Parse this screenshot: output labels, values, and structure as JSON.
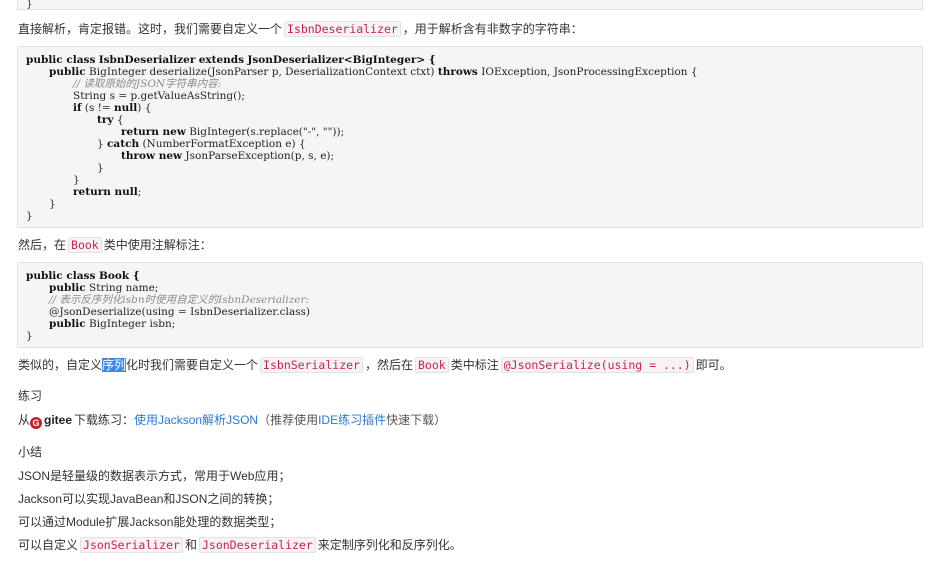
{
  "top_code": {
    "closing_brace": "}"
  },
  "intro": {
    "text_before": "直接解析，肯定报错。这时，我们需要自定义一个",
    "code": "IsbnDeserializer",
    "text_after": "，用于解析含有非数字的字符串："
  },
  "code_block_1": {
    "l1_kw": "public class",
    "l1_name": "IsbnDeserializer",
    "l1_kw2": "extends",
    "l1_parent": "JsonDeserializer<BigInteger> {",
    "l2_kw": "public",
    "l2_rest": " BigInteger deserialize(JsonParser p, DeserializationContext ctxt) ",
    "l2_kw2": "throws",
    "l2_rest2": " IOException, JsonProcessingException {",
    "l3_comment": "// 读取原始的JSON字符串内容:",
    "l4": "String s = p.getValueAsString();",
    "l5_kw": "if",
    "l5_rest": " (s != ",
    "l5_kw2": "null",
    "l5_rest2": ") {",
    "l6_kw": "try",
    "l6_rest": " {",
    "l7_kw": "return new",
    "l7_rest": " BigInteger(s.replace(\"-\", \"\"));",
    "l8_pre": "} ",
    "l8_kw": "catch",
    "l8_rest": " (NumberFormatException e) {",
    "l9_kw": "throw new",
    "l9_rest": " JsonParseException(p, s, e);",
    "l10": "}",
    "l11": "}",
    "l12_kw": "return null",
    "l12_rest": ";",
    "l13": "}",
    "l14": "}"
  },
  "then": {
    "text_before": "然后，在",
    "code": "Book",
    "text_after": "类中使用注解标注："
  },
  "code_block_2": {
    "l1_kw": "public class",
    "l1_rest": " Book {",
    "l2_kw": "public",
    "l2_rest": " String name;",
    "l3_comment": "// 表示反序列化isbn时使用自定义的IsbnDeserializer:",
    "l4": "@JsonDeserialize(using = IsbnDeserializer.class)",
    "l5_kw": "public",
    "l5_rest": " BigInteger isbn;",
    "l6": "}"
  },
  "similar": {
    "t1": "类似的，自定义",
    "t_hl": "序列",
    "t2": "化时我们需要自定义一个",
    "c1": "IsbnSerializer",
    "t3": "，然后在",
    "c2": "Book",
    "t4": "类中标注",
    "c3": "@JsonSerialize(using = ...)",
    "t5": "即可。"
  },
  "practice": {
    "heading": "练习",
    "from": "从",
    "gitee": "gitee",
    "download": "下载练习：",
    "link1": "使用Jackson解析JSON",
    "paren_open": "（推荐使用",
    "link2": "IDE练习插件",
    "paren_close": "快速下载）"
  },
  "summary": {
    "heading": "小结",
    "item1": "JSON是轻量级的数据表示方式，常用于Web应用；",
    "item2": "Jackson可以实现JavaBean和JSON之间的转换；",
    "item3": "可以通过Module扩展Jackson能处理的数据类型；",
    "item4_a": "可以自定义",
    "item4_c1": "JsonSerializer",
    "item4_b": "和",
    "item4_c2": "JsonDeserializer",
    "item4_d": "来定制序列化和反序列化。"
  }
}
